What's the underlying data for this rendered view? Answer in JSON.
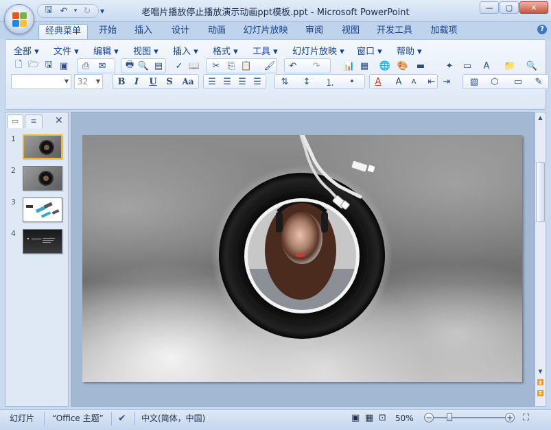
{
  "window": {
    "title": "老唱片播放停止播放演示动画ppt模板.ppt - Microsoft PowerPoint"
  },
  "quick_access": {
    "save_icon": "save-icon",
    "undo_icon": "undo-icon",
    "redo_icon": "redo-icon",
    "customize_icon": "customize-qat-icon"
  },
  "tabs": [
    {
      "label": "经典菜单"
    },
    {
      "label": "开始"
    },
    {
      "label": "插入"
    },
    {
      "label": "设计"
    },
    {
      "label": "动画"
    },
    {
      "label": "幻灯片放映"
    },
    {
      "label": "审阅"
    },
    {
      "label": "视图"
    },
    {
      "label": "开发工具"
    },
    {
      "label": "加载项"
    }
  ],
  "menubar": [
    {
      "label": "全部 ▾"
    },
    {
      "label": "文件 ▾"
    },
    {
      "label": "编辑 ▾"
    },
    {
      "label": "视图 ▾"
    },
    {
      "label": "插入 ▾"
    },
    {
      "label": "格式 ▾"
    },
    {
      "label": "工具 ▾"
    },
    {
      "label": "幻灯片放映 ▾"
    },
    {
      "label": "窗口 ▾"
    },
    {
      "label": "帮助 ▾"
    }
  ],
  "format_bar": {
    "font_name": "",
    "font_size": "32",
    "bold": "B",
    "italic": "I",
    "underline": "U",
    "shadow": "S",
    "change_case": "Aa"
  },
  "slides_panel": {
    "tab_slides_icon": "slides-tab-icon",
    "tab_outline_icon": "outline-tab-icon",
    "close": "✕",
    "slides": [
      {
        "number": "1"
      },
      {
        "number": "2"
      },
      {
        "number": "3"
      },
      {
        "number": "4"
      }
    ]
  },
  "statusbar": {
    "slide_label": "幻灯片",
    "theme": "“Office 主题”",
    "language": "中文(简体，中国)",
    "zoom": "50%"
  }
}
